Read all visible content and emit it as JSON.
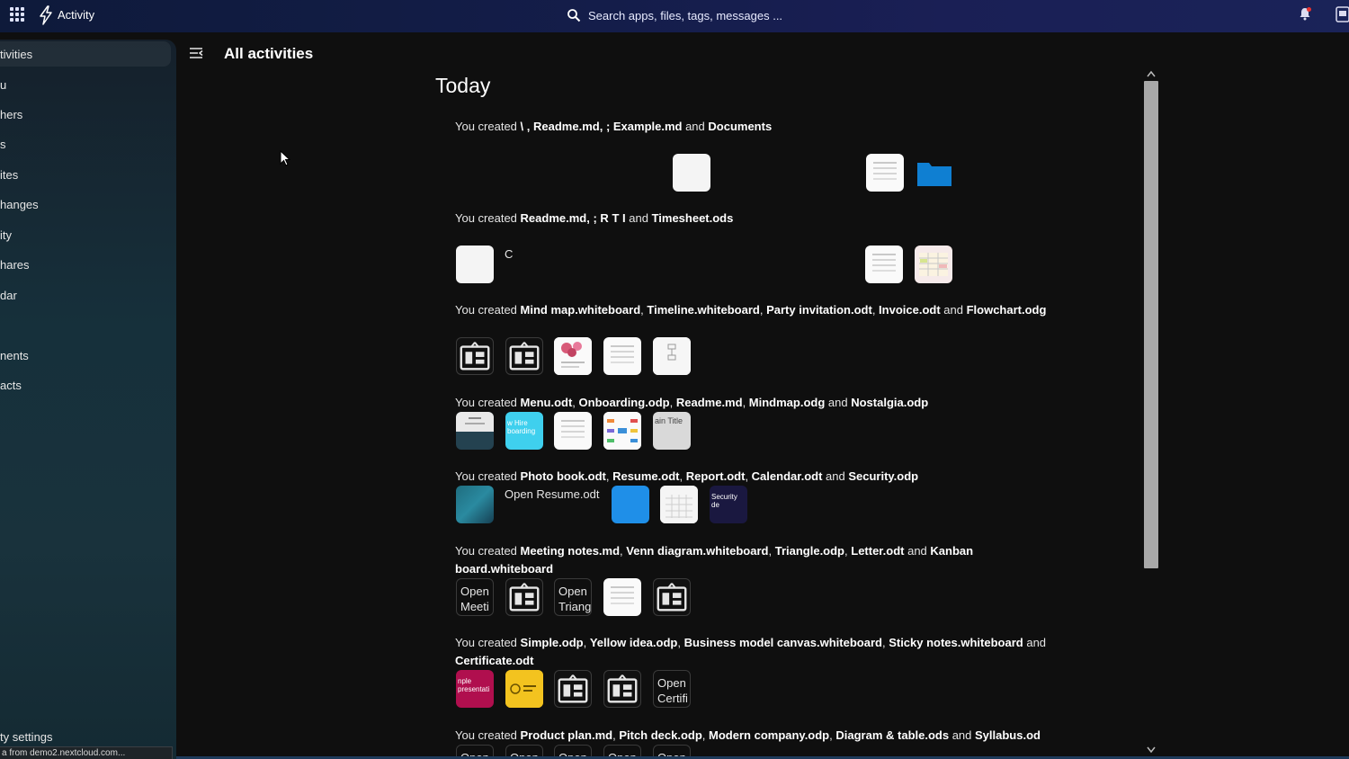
{
  "topbar": {
    "app_title": "Activity",
    "search_placeholder": "Search apps, files, tags, messages ..."
  },
  "sidebar": {
    "items": [
      {
        "label": "tivities"
      },
      {
        "label": "u"
      },
      {
        "label": "hers"
      },
      {
        "label": "s"
      },
      {
        "label": "ites"
      },
      {
        "label": "hanges"
      },
      {
        "label": "ity"
      },
      {
        "label": "hares"
      },
      {
        "label": "dar"
      },
      {
        "label": "nents"
      },
      {
        "label": "acts"
      }
    ],
    "settings_label": "ty settings"
  },
  "status_url": "a from demo2.nextcloud.com...",
  "main": {
    "page_title": "All activities",
    "day_title": "Today",
    "activities": [
      {
        "prefix": "You created ",
        "text_html": "You created <b>\\</b>  <span class='faded'>                                                    </span><b>, Readme.md,</b>  <span class='faded'>                              </span><b>; Example.md</b> and <b>Documents</b>"
      },
      {
        "text_html": "You created <b>Readme.md,</b>  <span class='faded'>                                               </span><b>; R</b>  <span class='faded'>                                                          </span><b>T</b>  <span class='faded'>                                   </span><b>I</b> and <b>Timesheet.ods</b>"
      },
      {
        "text_html": "You created <b>Mind map.whiteboard</b>, <b>Timeline.whiteboard</b>, <b>Party invitation.odt</b>, <b>Invoice.odt</b> and <b>Flowchart.odg</b>"
      },
      {
        "text_html": "You created <b>Menu.odt</b>, <b>Onboarding.odp</b>, <b>Readme.md</b>, <b>Mindmap.odg</b> and <b>Nostalgia.odp</b>"
      },
      {
        "text_html": "You created <b>Photo book.odt</b>, <b>Resume.odt</b>, <b>Report.odt</b>, <b>Calendar.odt</b> and <b>Security.odp</b>"
      },
      {
        "text_html": "You created <b>Meeting notes.md</b>, <b>Venn diagram.whiteboard</b>, <b>Triangle.odp</b>, <b>Letter.odt</b> and <b>Kanban board.whiteboard</b>"
      },
      {
        "text_html": "You created <b>Simple.odp</b>, <b>Yellow idea.odp</b>, <b>Business model canvas.whiteboard</b>, <b>Sticky notes.whiteboard</b> and <b>Certificate.odt</b>"
      },
      {
        "text_html": "You created <b>Product plan.md</b>, <b>Pitch deck.odp</b>, <b>Modern company.odp</b>, <b>Diagram &amp; table.ods</b> and <b>Syllabus.od</b>"
      }
    ],
    "thumb_labels": {
      "r2_c": "C",
      "onboarding": "w Hire boarding",
      "nostalgia": "ain Title",
      "open_resume": "Open Resume.odt",
      "security": "Security de",
      "open_meeting": "Open Meeti",
      "open_triangle": "Open Triang",
      "simple": "nple presentati",
      "open_certificate": "Open Certifi",
      "open_short": "Open"
    }
  },
  "colors": {
    "accent_blue": "#1f8fe8",
    "folder_blue": "#0f7fd2",
    "topbar": "#141d4a"
  }
}
